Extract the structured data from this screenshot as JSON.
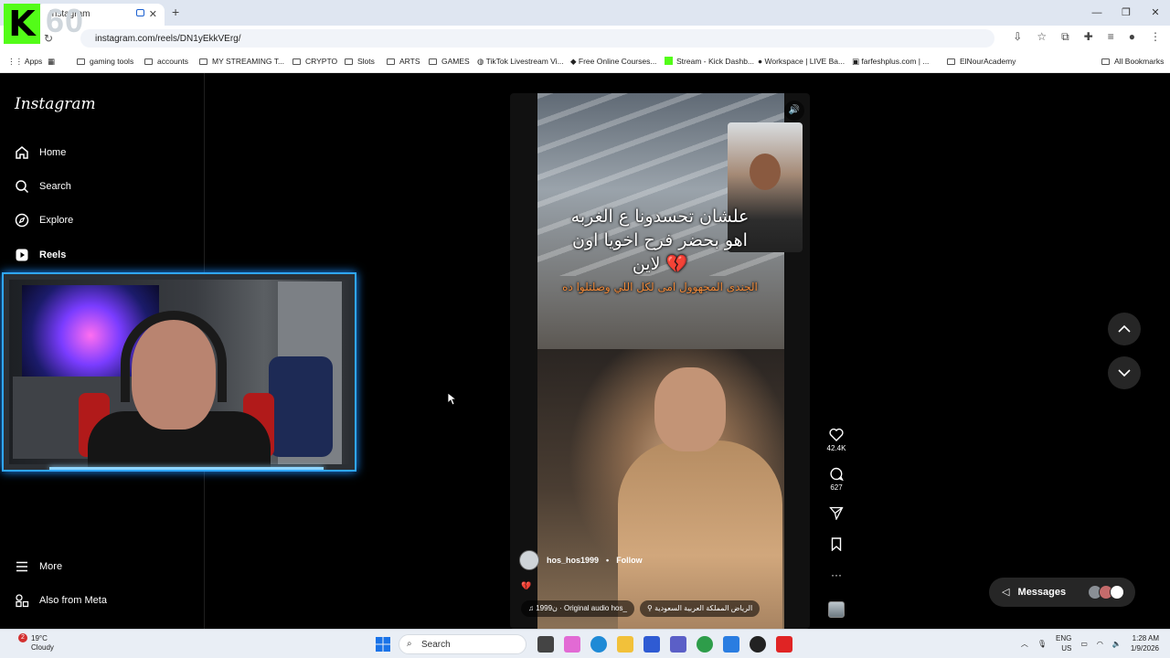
{
  "browser": {
    "tab_title": "Instagram",
    "url": "instagram.com/reels/DN1yEkkVErg/",
    "bookmarks": [
      "Apps",
      "gaming tools",
      "accounts",
      "MY STREAMING T...",
      "CRYPTO",
      "Slots",
      "ARTS",
      "GAMES",
      "TikTok Livestream Vi...",
      "Free Online Courses...",
      "Stream - Kick Dashb...",
      "Workspace | LIVE Ba...",
      "farfeshplus.com | ...",
      "ElNourAcademy"
    ],
    "all_bookmarks": "All Bookmarks"
  },
  "overlay": {
    "kick_letter": "K",
    "kick_count": "60"
  },
  "instagram": {
    "logo": "Instagram",
    "nav": {
      "home": "Home",
      "search": "Search",
      "explore": "Explore",
      "reels": "Reels",
      "more": "More",
      "also_from_meta": "Also from Meta"
    },
    "reel": {
      "caption_line1": "علشان تحسدونا ع الغربه",
      "caption_line2": "اهو بحضر فرح اخويا اون",
      "caption_line3": "لاين 💔",
      "caption_orange": "الجندى المجهوول امى لكل اللي وصلتلوا ده",
      "username": "hos_hos1999",
      "follow": "Follow",
      "audio": "♫ ن1999 · Original audio  hos_",
      "location": "الرياض المملكة العربية السعودية"
    },
    "actions": {
      "likes": "42.4K",
      "comments": "627"
    },
    "messages_label": "Messages"
  },
  "taskbar": {
    "weather_temp": "19°C",
    "weather_desc": "Cloudy",
    "weather_badge": "2",
    "search_label": "Search",
    "lang1": "ENG",
    "lang2": "US",
    "time": "1:28 AM",
    "date": "1/9/2026"
  }
}
